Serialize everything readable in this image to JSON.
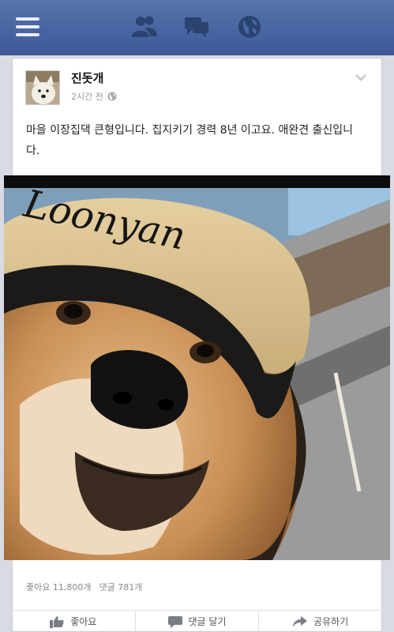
{
  "nav": {
    "icons": [
      "menu-icon",
      "friends-icon",
      "messages-icon",
      "globe-icon"
    ]
  },
  "post": {
    "author": "진돗개",
    "time": "2시간 전",
    "text": "마을 이장집댁 큰형입니다. 집지키기 경력 8년 이고요. 애완견 출신입니다."
  },
  "stats": {
    "likes": "좋아요 11,800개",
    "comments": "댓글 781개"
  },
  "actions": {
    "like": "좋아요",
    "comment": "댓글 달기",
    "share": "공유하기"
  },
  "colors": {
    "brand": "#3d5a98",
    "background": "#d8dbe2"
  }
}
